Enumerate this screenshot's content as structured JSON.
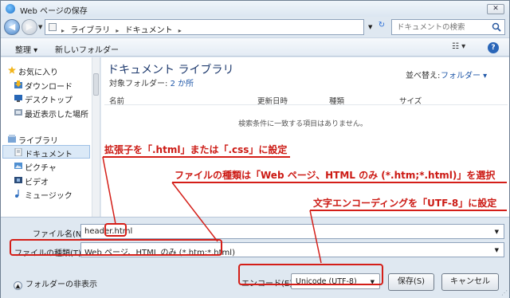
{
  "window": {
    "title": "Web ページの保存",
    "close_label": "✕"
  },
  "address": {
    "breadcrumb": [
      "ライブラリ",
      "ドキュメント"
    ],
    "separator": "▸",
    "refresh_glyph": "↻"
  },
  "search": {
    "placeholder": "ドキュメントの検索"
  },
  "toolbar": {
    "organize_label": "整理 ▾",
    "new_folder_label": "新しいフォルダー",
    "view_label": "☷ ▾",
    "help_label": "?"
  },
  "navpane": {
    "items": [
      {
        "label": "お気に入り",
        "icon": "star-icon"
      },
      {
        "label": "ダウンロード",
        "icon": "download-folder-icon"
      },
      {
        "label": "デスクトップ",
        "icon": "desktop-icon"
      },
      {
        "label": "最近表示した場所",
        "icon": "recent-places-icon"
      },
      {
        "label": "ライブラリ",
        "icon": "library-icon"
      },
      {
        "label": "ドキュメント",
        "icon": "documents-icon"
      },
      {
        "label": "ピクチャ",
        "icon": "pictures-icon"
      },
      {
        "label": "ビデオ",
        "icon": "videos-icon"
      },
      {
        "label": "ミュージック",
        "icon": "music-icon"
      }
    ]
  },
  "content": {
    "library_title": "ドキュメント ライブラリ",
    "subtitle_prefix": "対象フォルダー: ",
    "subtitle_link": "2 か所",
    "arrange_label": "並べ替え:",
    "arrange_value": "フォルダー ▾",
    "columns": [
      "名前",
      "更新日時",
      "種類",
      "サイズ"
    ],
    "empty_message": "検索条件に一致する項目はありません。"
  },
  "annotations": {
    "ext_note": "拡張子を「.html」または「.css」に設定",
    "type_note": "ファイルの種類は「Web ページ、HTML のみ (*.htm;*.html)」を選択",
    "encode_note": "文字エンコーディングを「UTF-8」に設定"
  },
  "form": {
    "filename_label": "ファイル名(N):",
    "filename_value_prefix": "header",
    "filename_value_suffix": ".html",
    "filetype_label": "ファイルの種類(T):",
    "filetype_value": "Web ページ、HTML のみ (*.htm;*.html)",
    "hide_folders_label": "フォルダーの非表示",
    "encode_label": "エンコード(E):",
    "encode_value": "Unicode (UTF-8)",
    "save_label": "保存(S)",
    "cancel_label": "キャンセル"
  },
  "colors": {
    "annotation": "#d41e18",
    "accent": "#1f57a8"
  }
}
